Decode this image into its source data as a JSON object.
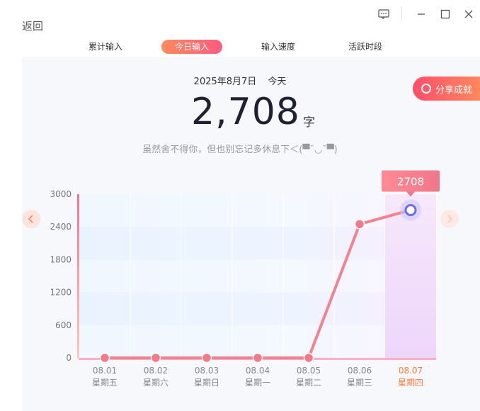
{
  "header": {
    "back_label": "返回"
  },
  "window_controls": [
    "feedback-icon",
    "minimize-icon",
    "maximize-icon",
    "close-icon"
  ],
  "tabs": [
    {
      "label": "累计输入",
      "active": false
    },
    {
      "label": "今日输入",
      "active": true
    },
    {
      "label": "输入速度",
      "active": false
    },
    {
      "label": "活跃时段",
      "active": false
    }
  ],
  "summary": {
    "date": "2025年8月7日",
    "day": "今天",
    "count": "2,708",
    "unit": "字",
    "tip": "虽然舍不得你，但也别忘记多休息下＜(▀˘◡˘▀)"
  },
  "share_button": {
    "label": "分享成就"
  },
  "colors": {
    "accent": "#ff5b7f",
    "orange": "#ff7a3d",
    "line": "#f2828f"
  },
  "chart_data": {
    "type": "line",
    "categories": [
      "08.01",
      "08.02",
      "08.03",
      "08.04",
      "08.05",
      "08.06",
      "08.07"
    ],
    "weekdays": [
      "星期五",
      "星期六",
      "星期日",
      "星期一",
      "星期二",
      "星期三",
      "星期四"
    ],
    "values": [
      0,
      0,
      0,
      0,
      0,
      2450,
      2708
    ],
    "ylim": [
      0,
      3000
    ],
    "yticks": [
      0,
      600,
      1200,
      1800,
      2400,
      3000
    ],
    "highlight_index": 6,
    "highlight_label": "2708",
    "grid": true
  }
}
